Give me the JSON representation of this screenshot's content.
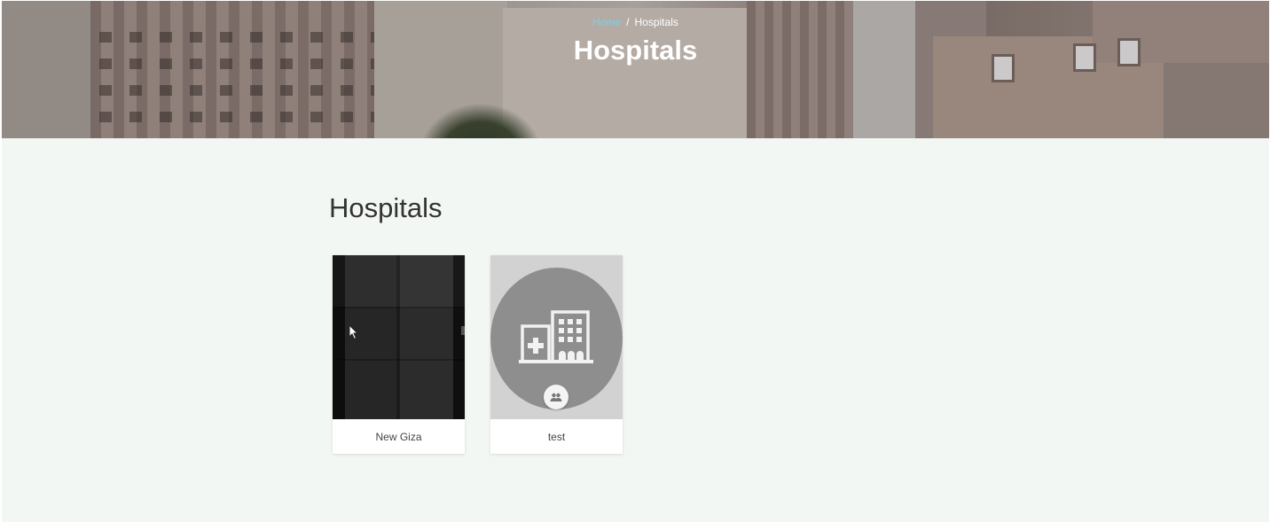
{
  "breadcrumb": {
    "home": "Home",
    "separator": "/",
    "current": "Hospitals"
  },
  "hero": {
    "title": "Hospitals"
  },
  "main": {
    "section_title": "Hospitals",
    "cards": [
      {
        "name": "New Giza",
        "media": "dark-cube-image"
      },
      {
        "name": "test",
        "media": "hospital-placeholder-icon",
        "badge_icon": "group-icon"
      }
    ]
  },
  "colors": {
    "page_bg": "#f3f7f4",
    "link": "#7fd0e8",
    "placeholder_circle": "#8e8e8e"
  }
}
